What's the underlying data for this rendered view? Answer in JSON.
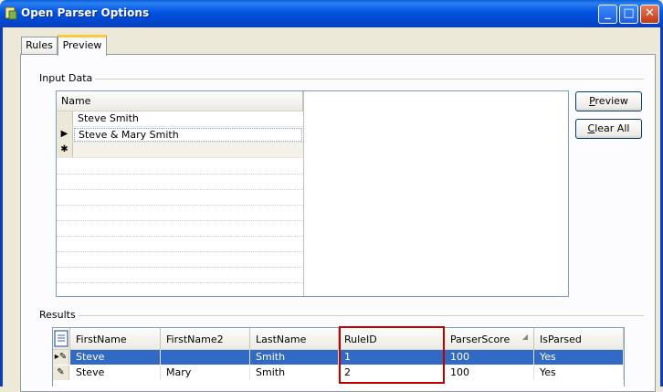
{
  "window": {
    "title": "Open Parser Options"
  },
  "tabs": [
    {
      "label": "Rules"
    },
    {
      "label": "Preview"
    }
  ],
  "input_data": {
    "group_label": "Input Data",
    "column_header": "Name",
    "rows": [
      {
        "name": "Steve Smith"
      },
      {
        "name": "Steve & Mary Smith"
      },
      {
        "name": ""
      }
    ]
  },
  "buttons": {
    "preview": {
      "access": "P",
      "rest": "review"
    },
    "clear_all": {
      "access": "C",
      "rest": "lear All"
    }
  },
  "results": {
    "group_label": "Results",
    "columns": [
      "FirstName",
      "FirstName2",
      "LastName",
      "RuleID",
      "ParserScore",
      "IsParsed"
    ],
    "rows": [
      {
        "FirstName": "Steve",
        "FirstName2": "",
        "LastName": "Smith",
        "RuleID": "1",
        "ParserScore": "100",
        "IsParsed": "Yes",
        "selected": true
      },
      {
        "FirstName": "Steve",
        "FirstName2": "Mary",
        "LastName": "Smith",
        "RuleID": "2",
        "ParserScore": "100",
        "IsParsed": "Yes",
        "selected": false
      }
    ]
  },
  "colors": {
    "selection": "#316ac5",
    "highlight_border": "#c00000",
    "tab_accent": "#ffc83c"
  }
}
